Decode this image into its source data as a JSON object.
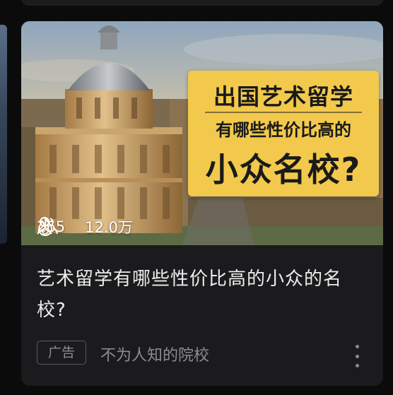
{
  "cover": {
    "overlay_line1": "出国艺术留学",
    "overlay_line2": "有哪些性价比高的",
    "overlay_line3": "小众名校?"
  },
  "stats": {
    "followers_icon": "users-icon",
    "followers_count": "265",
    "heat_icon": "flame-icon",
    "heat_count": "12.0万"
  },
  "post": {
    "title": "艺术留学有哪些性价比高的小众的名校?"
  },
  "ad": {
    "badge": "广告",
    "source": "不为人知的院校",
    "menu_icon": "more-vertical-icon"
  },
  "colors": {
    "overlay_bg": "#f2c94c",
    "card_bg": "#1b1b1e",
    "page_bg": "#0b0b0c"
  }
}
